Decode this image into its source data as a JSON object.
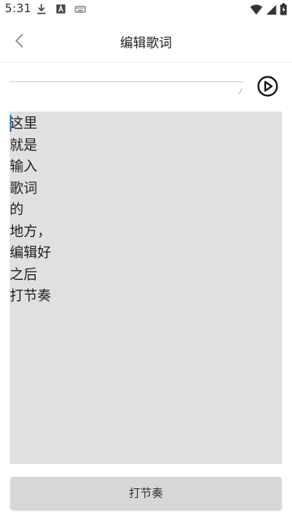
{
  "status_bar": {
    "time": "5:31",
    "left_icons": [
      "download-icon",
      "a-icon",
      "keyboard-icon"
    ],
    "right_icons": [
      "wifi-icon",
      "signal-icon",
      "battery-icon"
    ]
  },
  "app_bar": {
    "title": "编辑歌词",
    "back_icon": "chevron-left-icon"
  },
  "title_input": {
    "value": "",
    "placeholder": "",
    "counter": "/"
  },
  "play_icon": "play-circle-icon",
  "lyrics": {
    "text": "这里\n就是\n输入\n歌词\n的\n地方，\n编辑好\n之后\n打节奏"
  },
  "action_button": {
    "label": "打节奏"
  },
  "colors": {
    "lyrics_bg": "#e0e0e0",
    "button_bg": "#d7d7d7",
    "cursor": "#2a78d6"
  }
}
